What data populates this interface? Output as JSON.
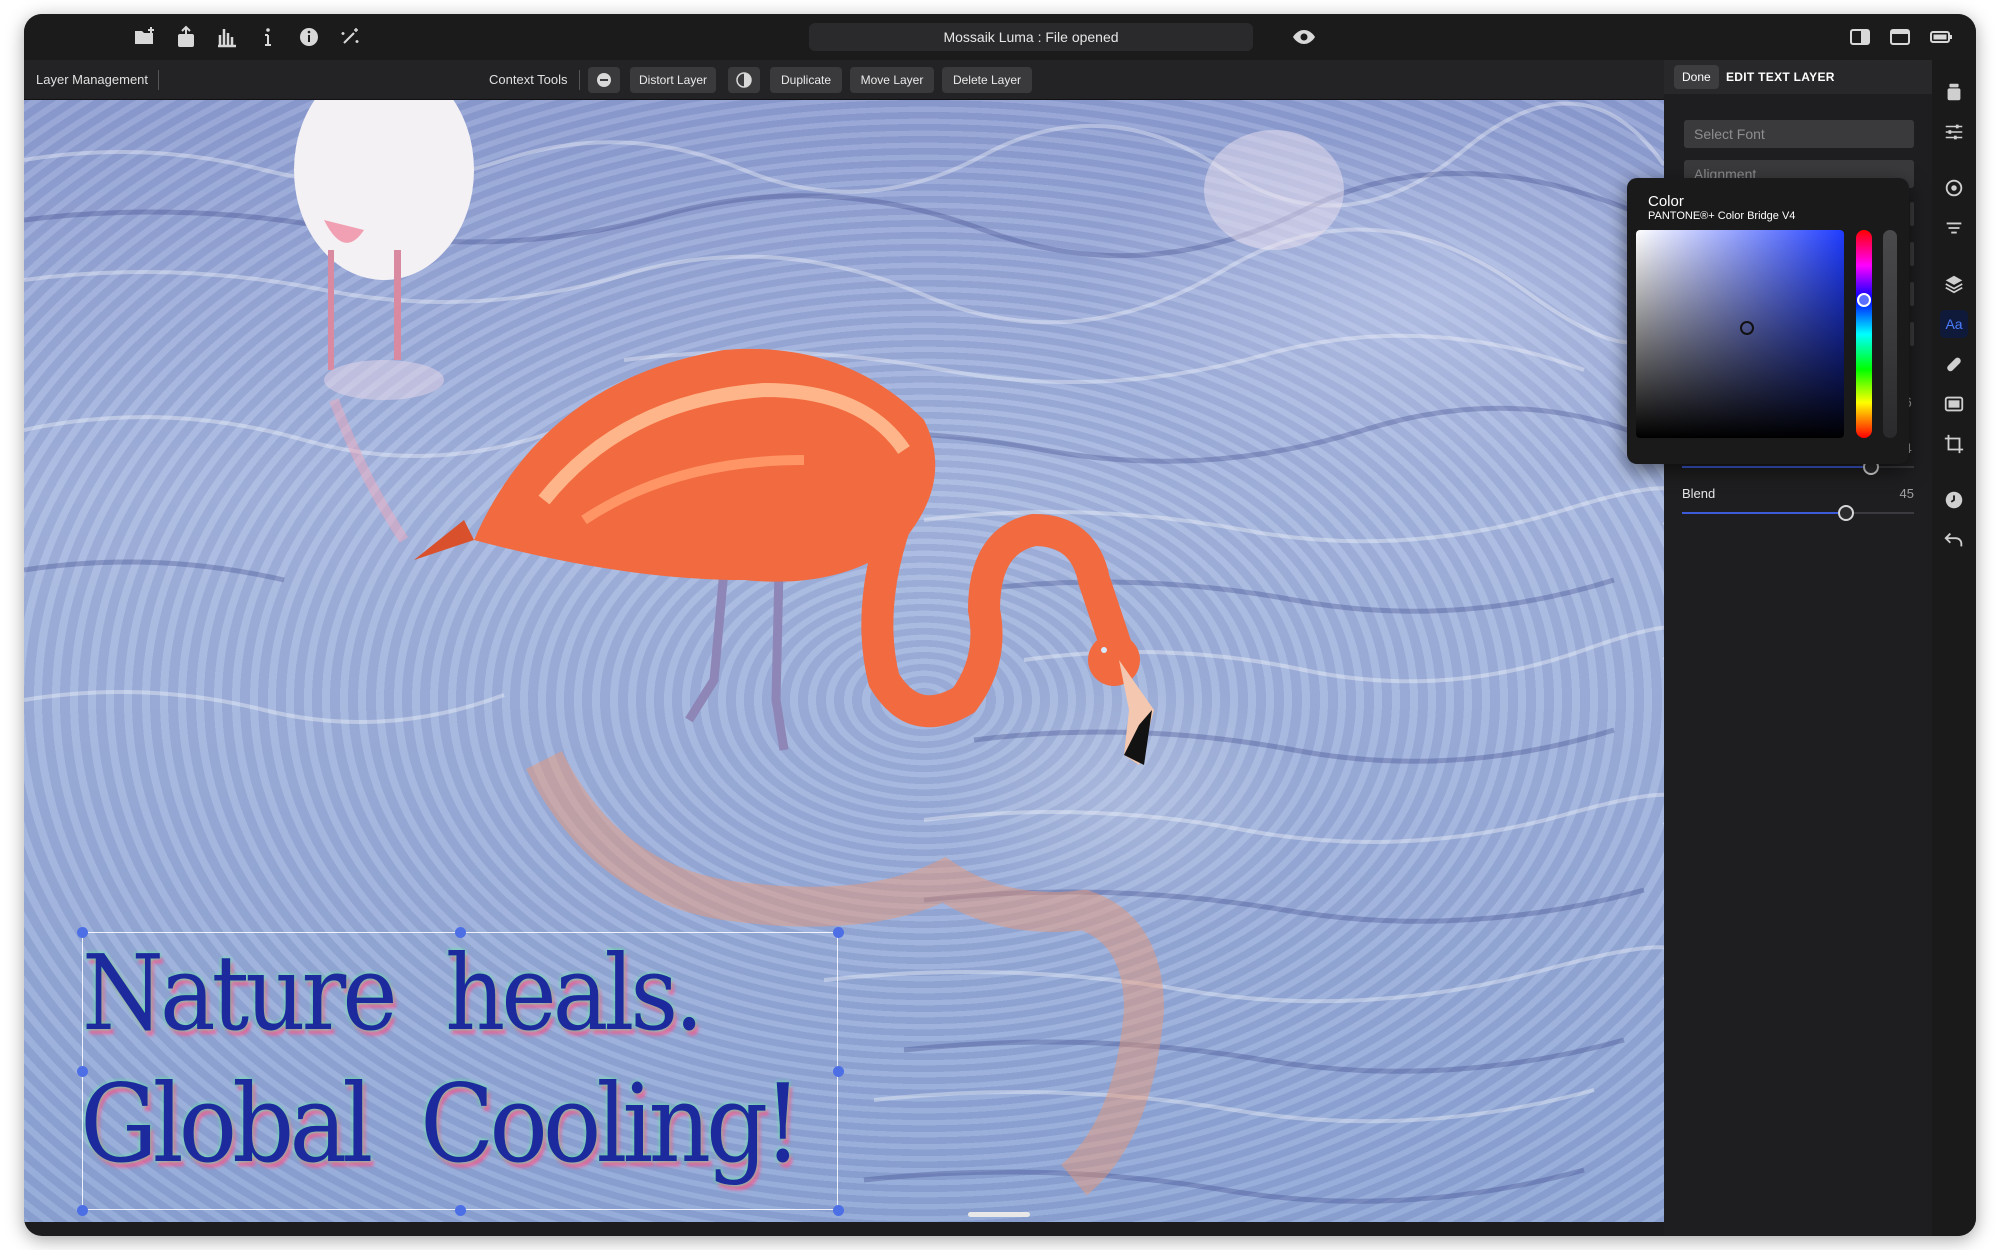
{
  "window": {
    "title": "Mossaik Luma : File opened",
    "titlebar_icons": [
      "open-file-icon",
      "share-icon",
      "histogram-icon",
      "info-icon",
      "info-circle-icon",
      "magic-select-icon",
      "eye-icon",
      "sidebar-toggle-icon",
      "window-layout-icon",
      "battery-icon"
    ]
  },
  "toolbar": {
    "left_label": "Layer Management",
    "context_label": "Context Tools",
    "buttons": [
      "Distort Layer",
      "Duplicate",
      "Move Layer",
      "Delete Layer"
    ],
    "icon_buttons": [
      "minus-circle-icon",
      "contrast-icon"
    ]
  },
  "canvas": {
    "text_line_1": "Nature  heals.",
    "text_line_2": "Global  Cooling!",
    "text_color": "#1d2a9e",
    "glow_color": "#5cf29a",
    "shadow_color": "#ff508c"
  },
  "panel": {
    "done_label": "Done",
    "title": "EDIT TEXT LAYER",
    "font_placeholder": "Select Font",
    "alignment_placeholder": "Alignment",
    "hidden_values": [
      "6",
      "4"
    ],
    "blend": {
      "label": "Blend",
      "value": "45",
      "level_percent": 68
    },
    "upper_slider_level_percent": 81
  },
  "color_picker": {
    "title": "Color",
    "subtitle": "PANTONE®+ Color Bridge V4",
    "selected_hue": "#1f3cff",
    "hue_knob_color": "#5a6fff"
  },
  "icon_strip": [
    "bucket-icon",
    "sliders-icon",
    "target-icon",
    "filter-lines-icon",
    "layers-icon",
    "text-icon",
    "bandage-icon",
    "frame-icon",
    "crop-icon",
    "clock-icon",
    "undo-icon"
  ],
  "icon_strip_active_label": "Aa",
  "accent_color": "#3d5bd6"
}
